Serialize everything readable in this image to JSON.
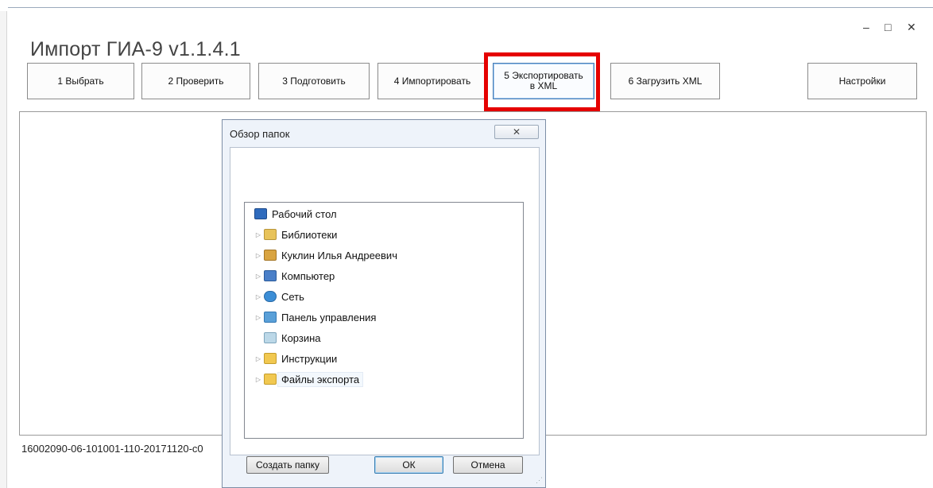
{
  "window": {
    "title": "Импорт ГИА-9 v1.1.4.1",
    "controls": {
      "minimize": "–",
      "maximize": "□",
      "close": "✕"
    }
  },
  "toolbar": {
    "buttons": [
      {
        "label": "1   Выбрать"
      },
      {
        "label": "2   Проверить"
      },
      {
        "label": "3  Подготовить"
      },
      {
        "label": "4 Импортировать"
      },
      {
        "label_line1": "5 Экспортировать",
        "label_line2": "в XML",
        "active": true
      },
      {
        "label": "6 Загрузить XML"
      },
      {
        "label": "Настройки"
      }
    ]
  },
  "status": {
    "file_text": "16002090-06-101001-110-20171120-c0"
  },
  "dialog": {
    "title": "Обзор папок",
    "close_glyph": "✕",
    "tree": [
      {
        "label": "Рабочий стол",
        "icon": "desktop-icon",
        "expandable": false,
        "indent": 0
      },
      {
        "label": "Библиотеки",
        "icon": "libraries-icon",
        "expandable": true,
        "indent": 1
      },
      {
        "label": "Куклин Илья Андреевич",
        "icon": "user-folder-icon",
        "expandable": true,
        "indent": 1
      },
      {
        "label": "Компьютер",
        "icon": "computer-icon",
        "expandable": true,
        "indent": 1
      },
      {
        "label": "Сеть",
        "icon": "network-icon",
        "expandable": true,
        "indent": 1
      },
      {
        "label": "Панель управления",
        "icon": "control-panel-icon",
        "expandable": true,
        "indent": 1
      },
      {
        "label": "Корзина",
        "icon": "recycle-bin-icon",
        "expandable": false,
        "indent": 1
      },
      {
        "label": "Инструкции",
        "icon": "folder-icon",
        "expandable": true,
        "indent": 1
      },
      {
        "label": "Файлы экспорта",
        "icon": "folder-icon",
        "expandable": true,
        "indent": 1,
        "selected": true
      }
    ],
    "buttons": {
      "create_folder": "Создать папку",
      "ok": "ОК",
      "cancel": "Отмена"
    }
  },
  "colors": {
    "highlight": "#e50000",
    "border": "#8b8b8b",
    "dialog_bg": "#eef3fa"
  }
}
